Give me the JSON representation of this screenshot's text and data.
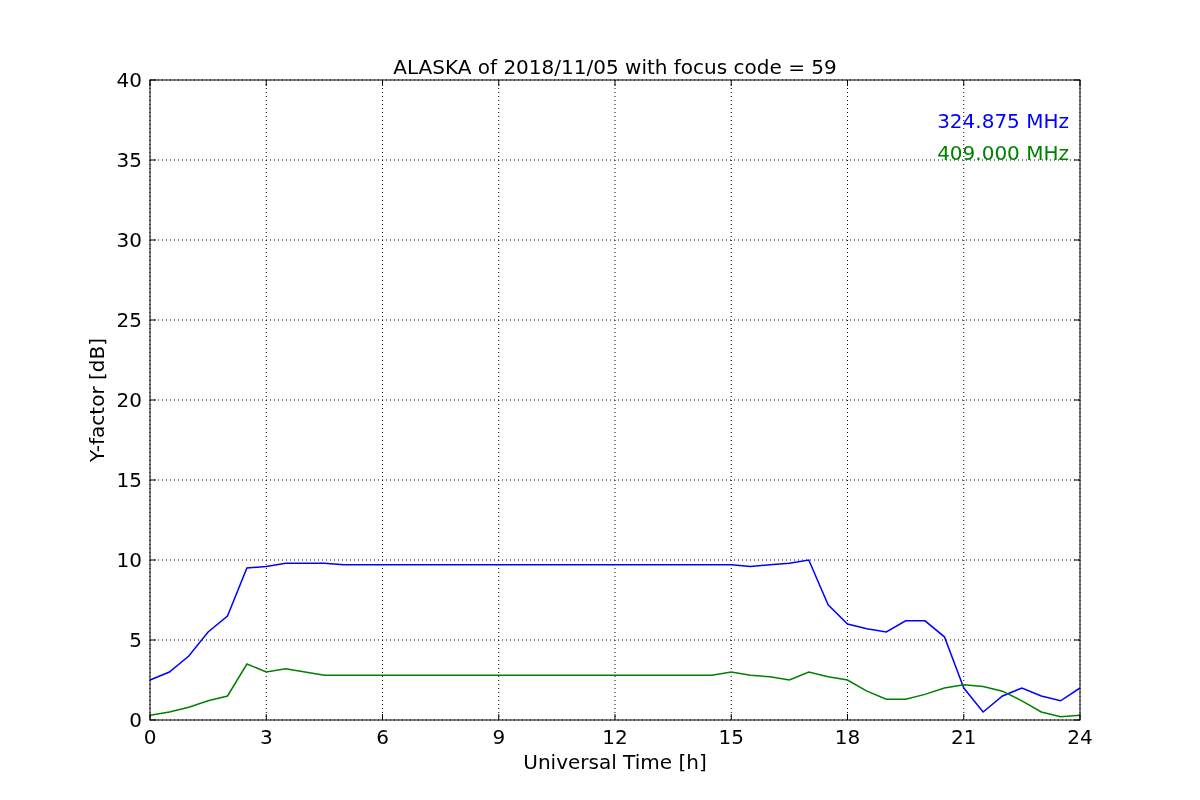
{
  "figure": {
    "chart_data": {
      "type": "line",
      "title": "ALASKA of 2018/11/05 with focus code = 59",
      "xlabel": "Universal Time [h]",
      "ylabel": "Y-factor [dB]",
      "x": [
        0,
        0.5,
        1,
        1.5,
        2,
        2.5,
        3,
        3.5,
        4,
        4.5,
        5,
        5.5,
        6,
        6.5,
        7,
        7.5,
        8,
        8.5,
        9,
        9.5,
        10,
        10.5,
        11,
        11.5,
        12,
        12.5,
        13,
        13.5,
        14,
        14.5,
        15,
        15.5,
        16,
        16.5,
        17,
        17.5,
        18,
        18.5,
        19,
        19.5,
        20,
        20.5,
        21,
        21.5,
        22,
        22.5,
        23,
        23.5,
        24
      ],
      "series": [
        {
          "name": "324.875 MHz",
          "color": "#0000ff",
          "values": [
            2.5,
            3,
            4,
            5.5,
            6.5,
            9.5,
            9.6,
            9.8,
            9.8,
            9.8,
            9.7,
            9.7,
            9.7,
            9.7,
            9.7,
            9.7,
            9.7,
            9.7,
            9.7,
            9.7,
            9.7,
            9.7,
            9.7,
            9.7,
            9.7,
            9.7,
            9.7,
            9.7,
            9.7,
            9.7,
            9.7,
            9.6,
            9.7,
            9.8,
            10,
            7.2,
            6,
            5.7,
            5.5,
            6.2,
            6.2,
            5.2,
            2,
            0.5,
            1.5,
            2,
            1.5,
            1.2,
            2
          ]
        },
        {
          "name": "409.000 MHz",
          "color": "#008000",
          "values": [
            0.3,
            0.5,
            0.8,
            1.2,
            1.5,
            3.5,
            3,
            3.2,
            3,
            2.8,
            2.8,
            2.8,
            2.8,
            2.8,
            2.8,
            2.8,
            2.8,
            2.8,
            2.8,
            2.8,
            2.8,
            2.8,
            2.8,
            2.8,
            2.8,
            2.8,
            2.8,
            2.8,
            2.8,
            2.8,
            3,
            2.8,
            2.7,
            2.5,
            3,
            2.7,
            2.5,
            1.8,
            1.3,
            1.3,
            1.6,
            2,
            2.2,
            2.1,
            1.8,
            1.2,
            0.5,
            0.2,
            0.3
          ]
        }
      ],
      "grid": true,
      "xlim": [
        0,
        24
      ],
      "ylim": [
        0,
        40
      ],
      "xticks": [
        0,
        3,
        6,
        9,
        12,
        15,
        18,
        21,
        24
      ],
      "yticks": [
        0,
        5,
        10,
        15,
        20,
        25,
        30,
        35,
        40
      ]
    }
  }
}
